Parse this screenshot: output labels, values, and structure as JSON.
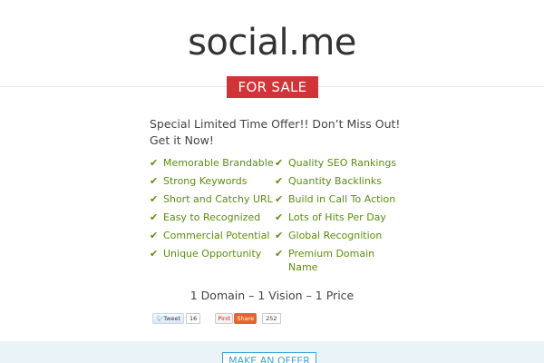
{
  "header": {
    "domain": "social.me",
    "badge": "FOR SALE"
  },
  "offer": {
    "line1": "Special Limited Time Offer!!  Don’t Miss Out!",
    "line2": "Get it Now!"
  },
  "features": {
    "left": [
      "Memorable Brandable",
      "Strong Keywords",
      "Short and Catchy URL",
      "Easy to Recognized",
      "Commercial Potential",
      "Unique Opportunity"
    ],
    "right": [
      "Quality SEO Rankings",
      "Quantity Backlinks",
      "Build in Call To Action",
      "Lots of Hits Per Day",
      "Global Recognition",
      "Premium Domain Name"
    ]
  },
  "tagline": "1 Domain – 1 Vision – 1 Price",
  "social": {
    "tweet_label": "Tweet",
    "tweet_count": "16",
    "pin_label": "Pinit",
    "share_label": "Share",
    "share_count": "252"
  },
  "cta": {
    "offer_button": "MAKE AN OFFER"
  },
  "colors": {
    "badge_bg": "#d13438",
    "feature_green": "#5a8f0a",
    "button_blue": "#36a6d6"
  }
}
